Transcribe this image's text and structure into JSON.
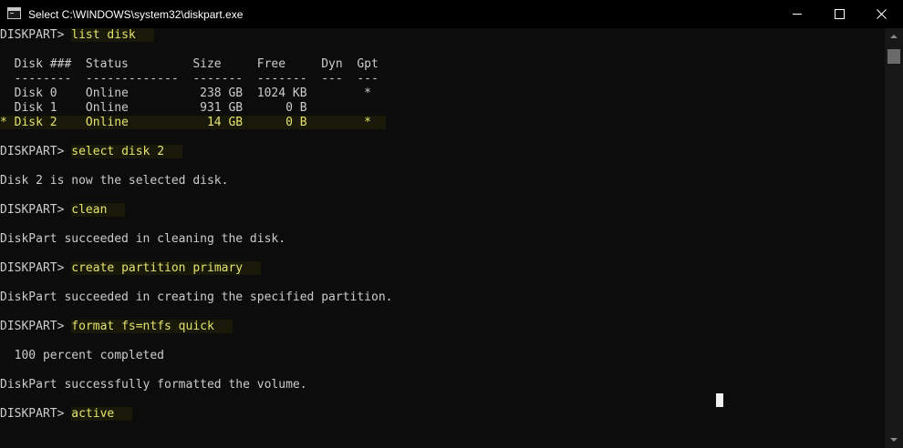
{
  "window": {
    "title": "Select C:\\WINDOWS\\system32\\diskpart.exe"
  },
  "colors": {
    "background": "#0c0c0c",
    "text": "#cccccc",
    "highlight_text": "#e5e36b",
    "highlight_bg": "#19190a",
    "titlebar": "#000000"
  },
  "terminal": {
    "prompt": "DISKPART> ",
    "lines": [
      {
        "type": "prompt",
        "command": "list disk"
      },
      {
        "type": "blank"
      },
      {
        "type": "text",
        "text": "  Disk ###  Status         Size     Free     Dyn  Gpt"
      },
      {
        "type": "text",
        "text": "  --------  -------------  -------  -------  ---  ---"
      },
      {
        "type": "text",
        "text": "  Disk 0    Online          238 GB  1024 KB        *"
      },
      {
        "type": "text",
        "text": "  Disk 1    Online          931 GB      0 B"
      },
      {
        "type": "selected",
        "text": "* Disk 2    Online           14 GB      0 B        *  "
      },
      {
        "type": "blank"
      },
      {
        "type": "prompt",
        "command": "select disk 2"
      },
      {
        "type": "blank"
      },
      {
        "type": "text",
        "text": "Disk 2 is now the selected disk."
      },
      {
        "type": "blank"
      },
      {
        "type": "prompt",
        "command": "clean"
      },
      {
        "type": "blank"
      },
      {
        "type": "text",
        "text": "DiskPart succeeded in cleaning the disk."
      },
      {
        "type": "blank"
      },
      {
        "type": "prompt",
        "command": "create partition primary"
      },
      {
        "type": "blank"
      },
      {
        "type": "text",
        "text": "DiskPart succeeded in creating the specified partition."
      },
      {
        "type": "blank"
      },
      {
        "type": "prompt",
        "command": "format fs=ntfs quick"
      },
      {
        "type": "blank"
      },
      {
        "type": "text",
        "text": "  100 percent completed"
      },
      {
        "type": "blank"
      },
      {
        "type": "text",
        "text": "DiskPart successfully formatted the volume."
      },
      {
        "type": "blank"
      },
      {
        "type": "prompt",
        "command": "active"
      }
    ]
  }
}
